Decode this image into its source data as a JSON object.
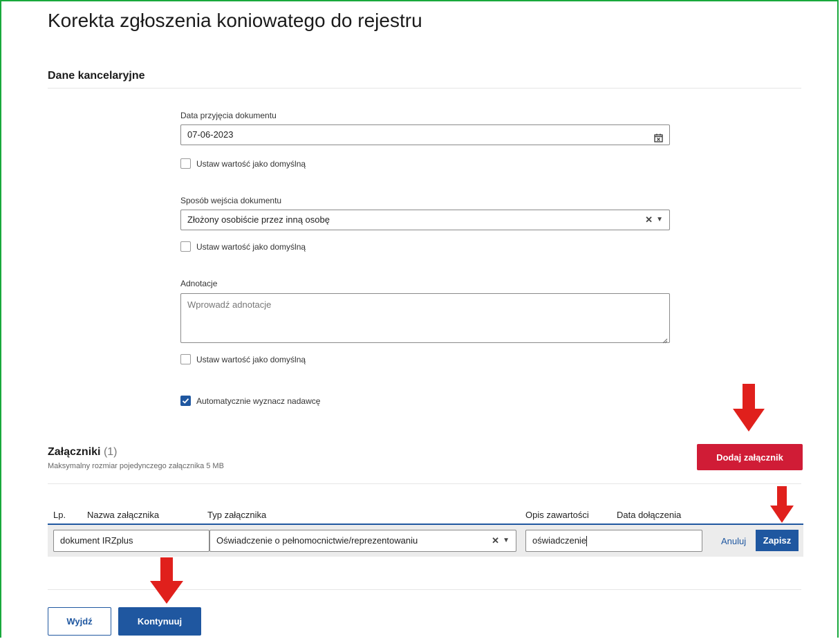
{
  "page": {
    "title": "Korekta zgłoszenia koniowatego do rejestru",
    "section_title": "Dane kancelaryjne"
  },
  "form": {
    "date": {
      "label": "Data przyjęcia dokumentu",
      "value": "07-06-2023",
      "icon": "calendar-icon",
      "default_label": "Ustaw wartość jako domyślną",
      "default_checked": false
    },
    "method": {
      "label": "Sposób wejścia dokumentu",
      "value": "Złożony osobiście przez inną osobę",
      "default_label": "Ustaw wartość jako domyślną",
      "default_checked": false
    },
    "notes": {
      "label": "Adnotacje",
      "placeholder": "Wprowadź adnotacje",
      "default_label": "Ustaw wartość jako domyślną",
      "default_checked": false
    },
    "auto_sender": {
      "label": "Automatycznie wyznacz nadawcę",
      "checked": true
    }
  },
  "attachments": {
    "title": "Załączniki",
    "count": "(1)",
    "subtitle": "Maksymalny rozmiar pojedynczego załącznika 5 MB",
    "add_button": "Dodaj załącznik",
    "columns": [
      "Lp.",
      "Nazwa załącznika",
      "Typ załącznika",
      "Opis zawartości",
      "Data dołączenia"
    ],
    "row": {
      "name": "dokument IRZplus",
      "type": "Oświadczenie o pełnomocnictwie/reprezentowaniu",
      "description": "oświadczenie"
    },
    "cancel_link": "Anuluj",
    "save_button": "Zapisz"
  },
  "footer": {
    "exit_button": "Wyjdź",
    "continue_button": "Kontynuuj"
  },
  "colors": {
    "accent": "#1f57a0",
    "danger": "#d01c36",
    "frame": "#19a83c",
    "annotation_arrow": "#e0201c"
  }
}
